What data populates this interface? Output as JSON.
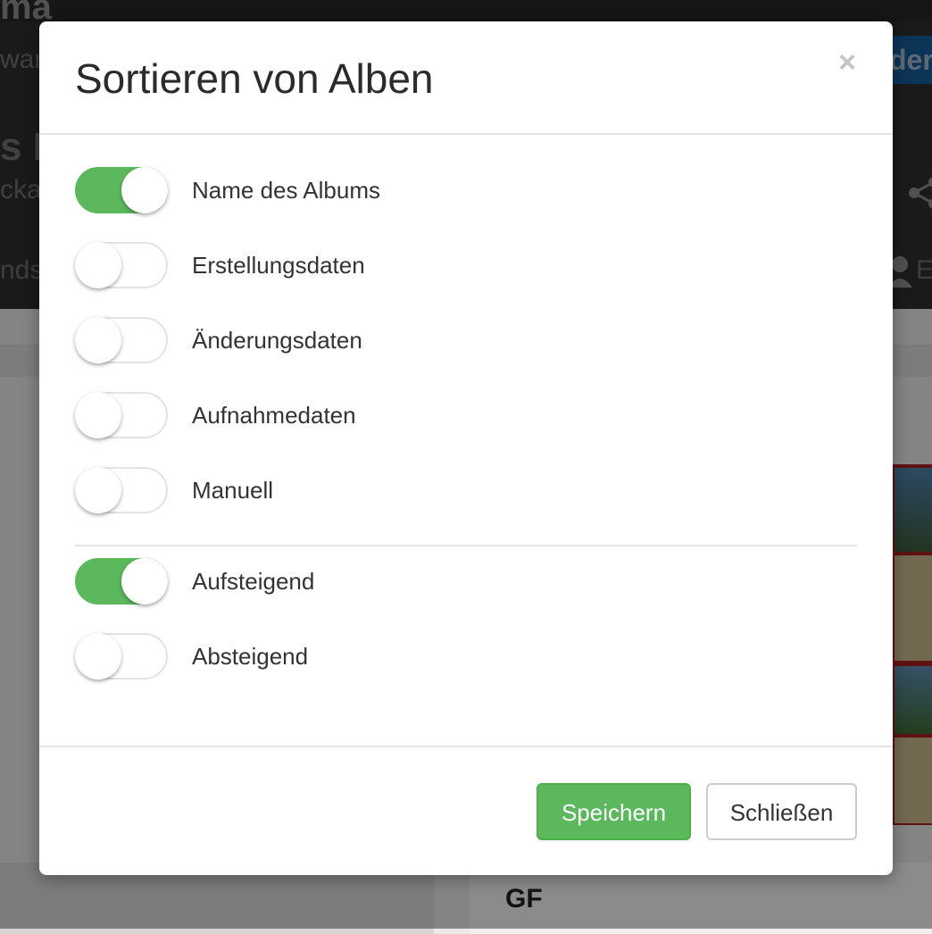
{
  "background": {
    "logo_fragment": "ma",
    "subtitle_fragment": "war",
    "page_title_fragment": "s P",
    "page_subtitle_fragment": "ckar",
    "nav_fragment": "ndsc",
    "nav_right_fragment": "E",
    "button_fragment": "der",
    "bottom_text": "GF"
  },
  "modal": {
    "title": "Sortieren von Alben",
    "close_symbol": "×",
    "sort_options": [
      {
        "label": "Name des Albums",
        "checked": true
      },
      {
        "label": "Erstellungsdaten",
        "checked": false
      },
      {
        "label": "Änderungsdaten",
        "checked": false
      },
      {
        "label": "Aufnahmedaten",
        "checked": false
      },
      {
        "label": "Manuell",
        "checked": false
      }
    ],
    "order_options": [
      {
        "label": "Aufsteigend",
        "checked": true
      },
      {
        "label": "Absteigend",
        "checked": false
      }
    ],
    "save_label": "Speichern",
    "close_label": "Schließen"
  },
  "colors": {
    "toggle_on": "#5cb85c",
    "save_button": "#5cb85c"
  }
}
